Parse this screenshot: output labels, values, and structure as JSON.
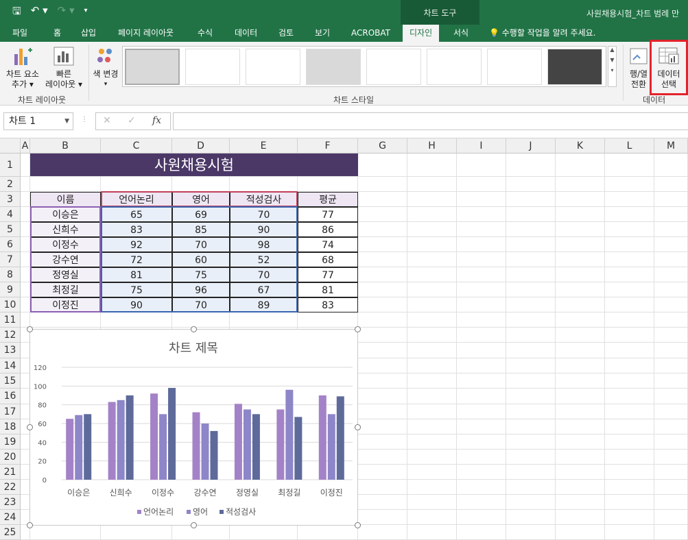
{
  "qat": {
    "save_icon": "save-icon",
    "undo_icon": "undo-icon",
    "redo_icon": "redo-icon",
    "customize_icon": "customize-qat-icon"
  },
  "context_tab": "차트 도구",
  "window_title": "사원채용시험_차트 범례 만",
  "tabs": [
    "파일",
    "홈",
    "삽입",
    "페이지 레이아웃",
    "수식",
    "데이터",
    "검토",
    "보기",
    "ACROBAT",
    "디자인",
    "서식"
  ],
  "active_tab": "디자인",
  "tell_me": "수행할 작업을 알려 주세요.",
  "ribbon": {
    "add_element": [
      "차트 요소",
      "추가 ▾"
    ],
    "quick_layout": [
      "빠른",
      "레이아웃 ▾"
    ],
    "change_colors": "색 변경",
    "group_layout": "차트 레이아웃",
    "group_styles": "차트 스타일",
    "switch_rowcol": [
      "행/열",
      "전환"
    ],
    "select_data": [
      "데이터",
      "선택"
    ],
    "group_data": "데이터"
  },
  "formula_bar": {
    "name_box": "차트 1",
    "cancel": "✕",
    "enter": "✓",
    "fx": "fx",
    "formula": ""
  },
  "columns": [
    "A",
    "B",
    "C",
    "D",
    "E",
    "F",
    "G",
    "H",
    "I",
    "J",
    "K",
    "L",
    "M"
  ],
  "rows": [
    "1",
    "2",
    "3",
    "4",
    "5",
    "6",
    "7",
    "8",
    "9",
    "10",
    "11",
    "12",
    "13",
    "14",
    "15",
    "16",
    "17",
    "18",
    "19",
    "20",
    "21",
    "22",
    "23",
    "24",
    "25"
  ],
  "sheet": {
    "title": "사원채용시험",
    "headers": [
      "이름",
      "언어논리",
      "영어",
      "적성검사",
      "평균"
    ],
    "records": [
      [
        "이승은",
        "65",
        "69",
        "70",
        "77"
      ],
      [
        "신희수",
        "83",
        "85",
        "90",
        "86"
      ],
      [
        "이정수",
        "92",
        "70",
        "98",
        "74"
      ],
      [
        "강수연",
        "72",
        "60",
        "52",
        "68"
      ],
      [
        "정영실",
        "81",
        "75",
        "70",
        "77"
      ],
      [
        "최정길",
        "75",
        "96",
        "67",
        "81"
      ],
      [
        "이정진",
        "90",
        "70",
        "89",
        "83"
      ]
    ]
  },
  "colors": {
    "excel_green": "#217346",
    "title_purple": "#4b3867",
    "header_fill": "#eee6f3",
    "s1": "#a482c7",
    "s2": "#8d86c9",
    "s3": "#5e6a9a",
    "highlight": "#e3232c"
  },
  "chart_data": {
    "type": "bar",
    "title": "차트 제목",
    "categories": [
      "이승은",
      "신희수",
      "이정수",
      "강수연",
      "정영실",
      "최정길",
      "이정진"
    ],
    "series": [
      {
        "name": "언어논리",
        "values": [
          65,
          83,
          92,
          72,
          81,
          75,
          90
        ]
      },
      {
        "name": "영어",
        "values": [
          69,
          85,
          70,
          60,
          75,
          96,
          70
        ]
      },
      {
        "name": "적성검사",
        "values": [
          70,
          90,
          98,
          52,
          70,
          67,
          89
        ]
      }
    ],
    "ylim": [
      0,
      120
    ],
    "yticks": [
      "0",
      "20",
      "40",
      "60",
      "80",
      "100",
      "120"
    ],
    "grid": true,
    "legend": "bottom"
  }
}
